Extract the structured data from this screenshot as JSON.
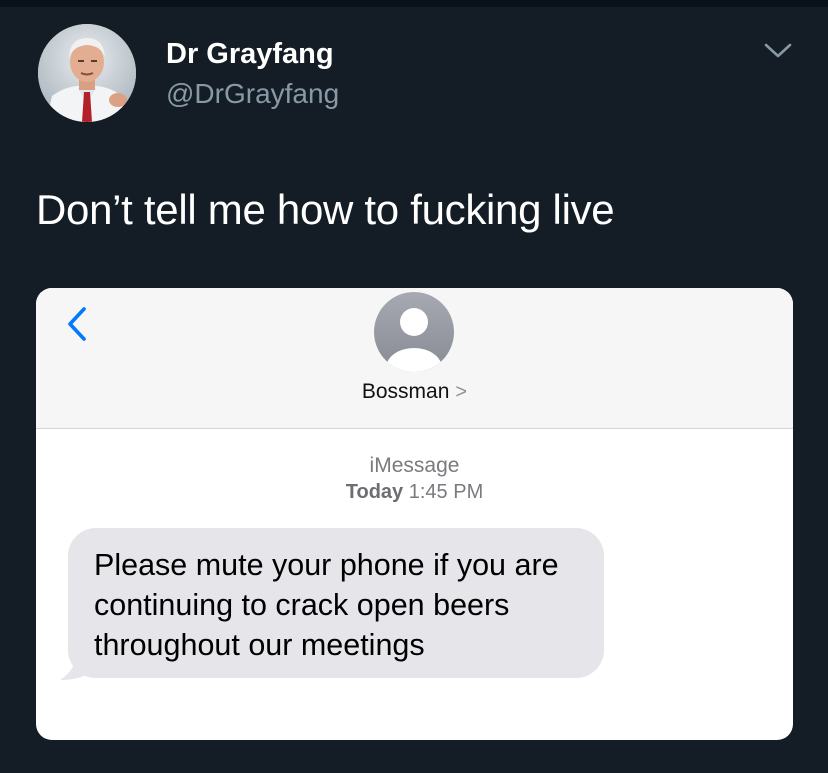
{
  "tweet": {
    "author": {
      "display_name": "Dr Grayfang",
      "handle": "@DrGrayfang"
    },
    "text": "Don’t tell me how to fucking live"
  },
  "screenshot": {
    "contact": {
      "name": "Bossman",
      "chevron": ">"
    },
    "service": "iMessage",
    "timestamp_day": "Today",
    "timestamp_time": "1:45 PM",
    "message": "Please mute your phone if you are continuing to crack open beers throughout our meetings"
  },
  "colors": {
    "background": "#141d26",
    "handle": "#8899a6",
    "ios_blue": "#007aff",
    "bubble_gray": "#e5e5ea"
  },
  "icons": {
    "menu": "chevron-down-icon",
    "back": "chevron-left-icon",
    "contact": "person-circle-icon"
  }
}
